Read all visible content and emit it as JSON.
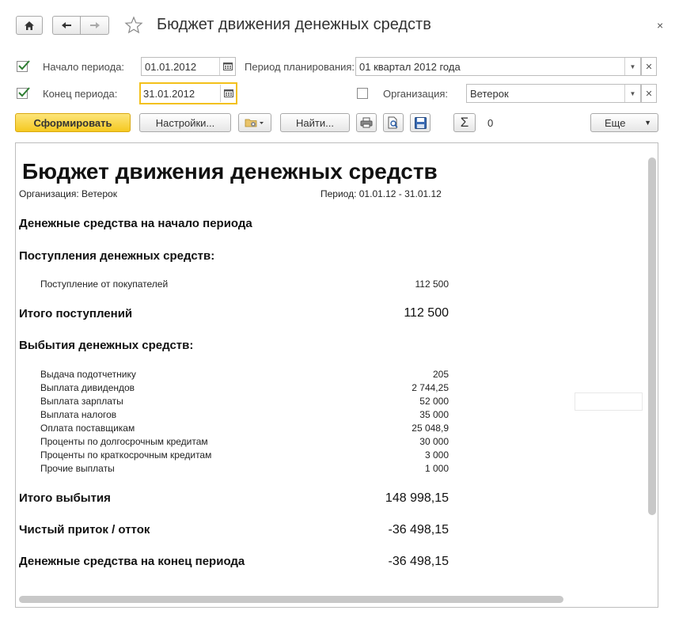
{
  "window": {
    "title": "Бюджет движения денежных средств",
    "close_glyph": "×"
  },
  "form": {
    "period_start": {
      "label": "Начало периода:",
      "value": "01.01.2012",
      "checked": true
    },
    "period_end": {
      "label": "Конец периода:",
      "value": "31.01.2012",
      "checked": true
    },
    "planning_period": {
      "label": "Период планирования:",
      "value": "01 квартал 2012 года"
    },
    "organization": {
      "label": "Организация:",
      "value": "Ветерок",
      "checked": false
    }
  },
  "toolbar": {
    "generate_label": "Сформировать",
    "settings_label": "Настройки...",
    "find_label": "Найти...",
    "sum_value": "0",
    "more_label": "Еще"
  },
  "report": {
    "title": "Бюджет движения денежных средств",
    "organization_line": "Организация: Ветерок",
    "period_line": "Период: 01.01.12 - 31.01.12",
    "cash_start_heading": "Денежные средства на начало периода",
    "receipts_heading": "Поступления денежных средств:",
    "receipts": [
      {
        "label": "Поступление от покупателей",
        "value": "112 500"
      }
    ],
    "receipts_total_label": "Итого поступлений",
    "receipts_total_value": "112 500",
    "disposals_heading": "Выбытия денежных средств:",
    "disposals": [
      {
        "label": "Выдача подотчетнику",
        "value": "205"
      },
      {
        "label": "Выплата дивидендов",
        "value": "2 744,25"
      },
      {
        "label": "Выплата зарплаты",
        "value": "52 000"
      },
      {
        "label": "Выплата налогов",
        "value": "35 000"
      },
      {
        "label": "Оплата поставщикам",
        "value": "25 048,9"
      },
      {
        "label": "Проценты по долгосрочным кредитам",
        "value": "30 000"
      },
      {
        "label": "Проценты по краткосрочным кредитам",
        "value": "3 000"
      },
      {
        "label": "Прочие выплаты",
        "value": "1 000"
      }
    ],
    "disposals_total_label": "Итого выбытия",
    "disposals_total_value": "148 998,15",
    "net_flow_label": "Чистый приток / отток",
    "net_flow_value": "-36 498,15",
    "cash_end_label": "Денежные средства на конец периода",
    "cash_end_value": "-36 498,15"
  },
  "colors": {
    "primary_button": "#f5c921",
    "focus_border": "#f3c11a",
    "checkmark": "#2e7d32"
  }
}
